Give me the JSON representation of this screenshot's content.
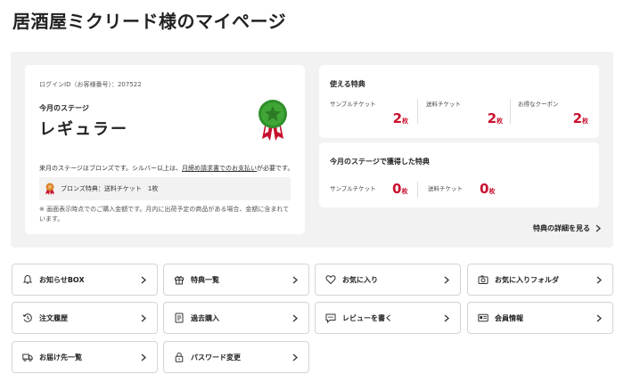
{
  "page": {
    "title": "居酒屋ミクリード様のマイページ"
  },
  "stage": {
    "login_id": "ログインID（お客様番号）：207522",
    "label": "今月のステージ",
    "name": "レギュラー",
    "next_prefix": "来月のステージはブロンズです。シルバー以上は、",
    "next_link": "月締め請求書でのお支払い",
    "next_suffix": "が必要です。",
    "bronze_benefit": "ブロンズ特典：送料チケット　1枚",
    "note": "※ 画面表示時点でのご購入金額です。月内に出荷予定の商品がある場合、金額に含まれています。",
    "medal_color": "#3fa535",
    "accent": "#c8102e"
  },
  "available": {
    "title": "使える特典",
    "items": [
      {
        "label": "サンプルチケット",
        "count": "2",
        "unit": "枚"
      },
      {
        "label": "送料チケット",
        "count": "2",
        "unit": "枚"
      },
      {
        "label": "お得なクーポン",
        "count": "2",
        "unit": "枚"
      }
    ]
  },
  "earned": {
    "title": "今月のステージで獲得した特典",
    "items": [
      {
        "label": "サンプルチケット",
        "count": "0",
        "unit": "枚"
      },
      {
        "label": "送料チケット",
        "count": "0",
        "unit": "枚"
      }
    ]
  },
  "detail_link": "特典の詳細を見る",
  "menu": [
    {
      "label": "お知らせBOX",
      "icon": "bell-icon"
    },
    {
      "label": "特典一覧",
      "icon": "gift-icon"
    },
    {
      "label": "お気に入り",
      "icon": "heart-icon"
    },
    {
      "label": "お気に入りフォルダ",
      "icon": "folder-camera-icon"
    },
    {
      "label": "注文履歴",
      "icon": "history-icon"
    },
    {
      "label": "過去購入",
      "icon": "document-icon"
    },
    {
      "label": "レビューを書く",
      "icon": "speech-bubble-icon"
    },
    {
      "label": "会員情報",
      "icon": "id-card-icon"
    },
    {
      "label": "お届け先一覧",
      "icon": "truck-icon"
    },
    {
      "label": "パスワード変更",
      "icon": "lock-icon"
    }
  ]
}
